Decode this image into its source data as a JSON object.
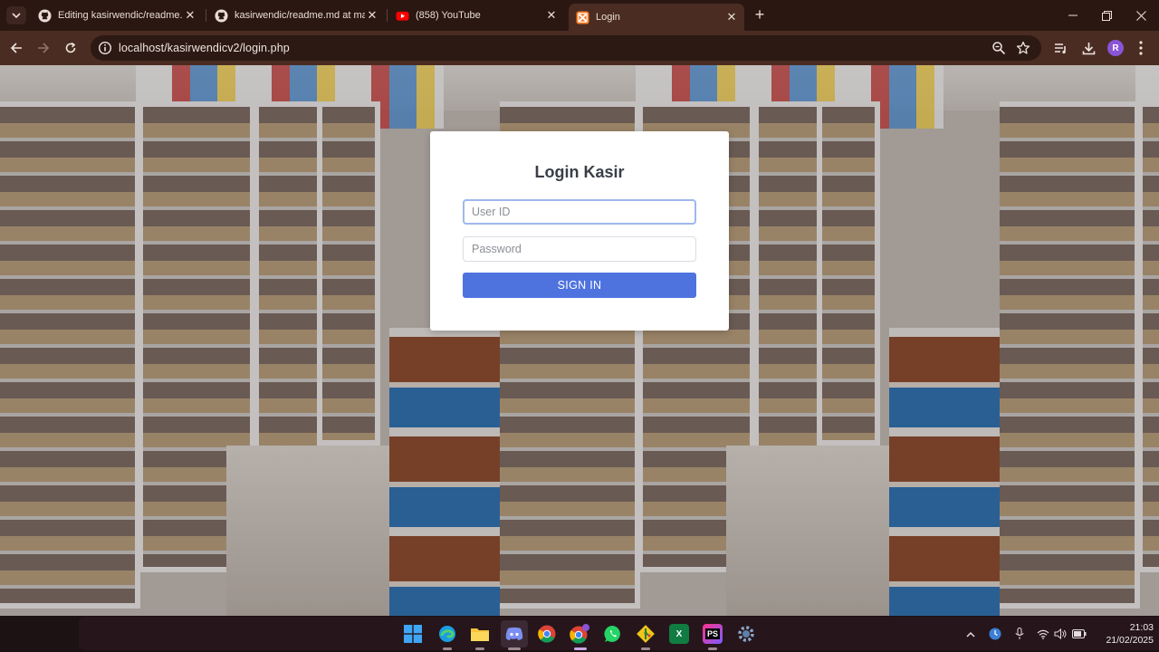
{
  "browser": {
    "tabs": [
      {
        "title": "Editing kasirwendic/readme.md",
        "favicon": "github-icon",
        "active": false
      },
      {
        "title": "kasirwendic/readme.md at main",
        "favicon": "github-icon",
        "active": false
      },
      {
        "title": "(858) YouTube",
        "favicon": "youtube-icon",
        "active": false
      },
      {
        "title": "Login",
        "favicon": "xampp-icon",
        "active": true
      }
    ],
    "url": "localhost/kasirwendicv2/login.php",
    "profile_initial": "R",
    "colors": {
      "frame": "#2a1712",
      "toolbar": "#4a2c22"
    }
  },
  "login": {
    "title": "Login Kasir",
    "user_placeholder": "User ID",
    "password_placeholder": "Password",
    "submit_label": "SIGN IN",
    "button_color": "#4e73df"
  },
  "taskbar": {
    "apps": [
      "windows-start-icon",
      "edge-icon",
      "file-explorer-icon",
      "discord-icon",
      "chrome-icon",
      "chrome-profile-icon",
      "whatsapp-icon",
      "git-icon",
      "excel-icon",
      "phpstorm-icon",
      "settings-icon"
    ],
    "time": "21:03",
    "date": "21/02/2025"
  }
}
